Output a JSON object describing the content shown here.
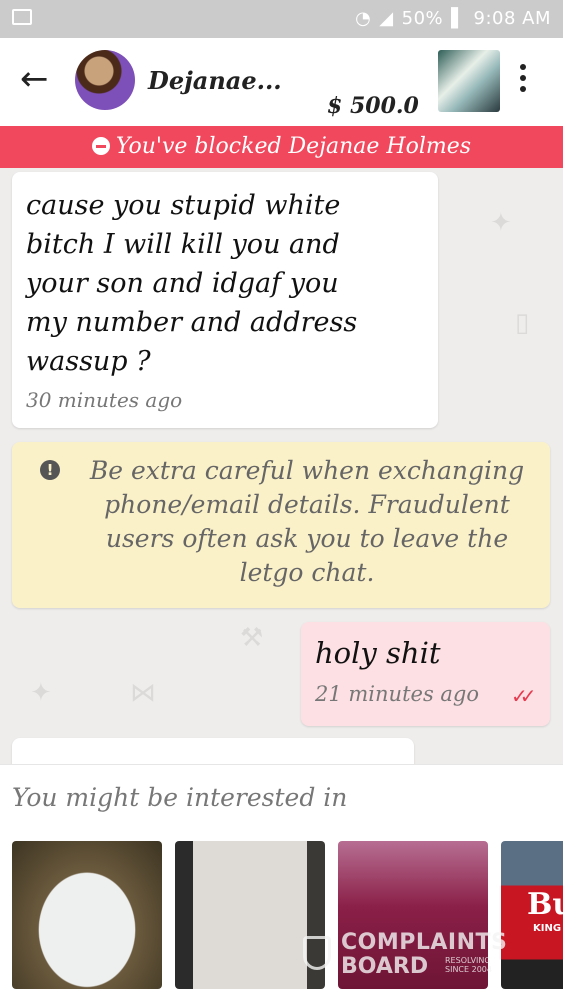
{
  "status_bar": {
    "battery": "50%",
    "time": "9:08 AM"
  },
  "header": {
    "contact_name": "Dejanae...",
    "price": "$ 500.0"
  },
  "banner": {
    "text": "You've blocked Dejanae Holmes"
  },
  "messages": [
    {
      "direction": "incoming",
      "text": "cause you stupid white\nbitch I will kill you and\nyour son and idgaf you\nmy number and address\nwassup ?",
      "time": "30 minutes ago"
    },
    {
      "direction": "outgoing",
      "text": "holy shit",
      "time": "21 minutes ago"
    }
  ],
  "warning": {
    "text": "Be extra careful when exchanging\nphone/email details. Fraudulent\nusers often ask you to leave the\nletgo chat."
  },
  "suggestions": {
    "title": "You might be interested in",
    "products": [
      {
        "image": "white car hood on dirt"
      },
      {
        "image": "gray car hood close-up"
      },
      {
        "image": "maroon car hood"
      },
      {
        "image": "red Budweiser banner on truck",
        "text_1": "Bu",
        "text_2": "KING O"
      }
    ]
  },
  "watermark": {
    "line1": "COMPLAINTS",
    "line2": "BOARD",
    "line3": "RESOLVING\nSINCE 2004"
  },
  "colors": {
    "banner": "#f2485d",
    "warning_bg": "#fbf1c9",
    "outgoing_bg": "#fde0e3",
    "read_ticks": "#e63a4f"
  },
  "icons": [
    "image-icon",
    "wifi-icon",
    "signal-icon",
    "battery-icon",
    "back-arrow-icon",
    "more-vert-icon",
    "blocked-icon",
    "info-icon",
    "double-check-icon"
  ]
}
